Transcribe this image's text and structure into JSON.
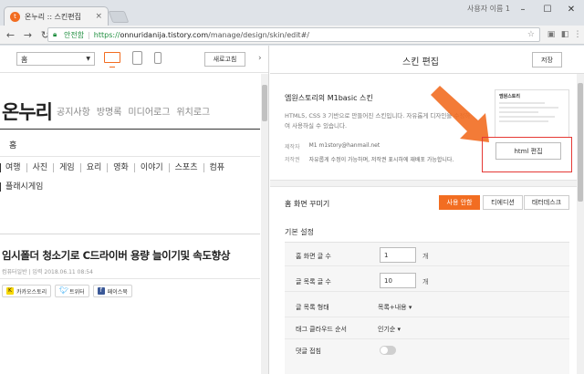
{
  "browser": {
    "tab_title": "온누리 :: 스킨편집",
    "tab_close": "×",
    "user_name": "사용자 이름 1",
    "win_min": "–",
    "win_max": "☐",
    "win_close": "✕",
    "back": "←",
    "forward": "→",
    "reload": "↻",
    "secure_label": "안전함",
    "url_scheme": "https://",
    "url_host": "onnuridanija.tistory.com",
    "url_path": "/manage/design/skin/edit#/",
    "star": "☆"
  },
  "preview": {
    "select_value": "홈",
    "refresh_label": "새로고침",
    "collapse": "›",
    "blog_title": "온누리",
    "nav": [
      "공지사항",
      "방명록",
      "미디어로그",
      "위치로그"
    ],
    "home_link": "홈",
    "categories": [
      "여행",
      "사진",
      "게임",
      "요리",
      "영화",
      "이야기",
      "스포츠",
      "컴퓨"
    ],
    "category_row2": "플래시게임",
    "post_title": "임시폴더 청소기로 C드라이버 용량 늘이기및 속도향상",
    "post_meta": "컴퓨터일반 | 입력 2018.06.11 08:54",
    "share": [
      "카카오스토리",
      "트위터",
      "페이스북"
    ]
  },
  "editor": {
    "title": "스킨 편집",
    "save_label": "저장",
    "skin_name": "엠원스토리의 M1basic 스킨",
    "skin_desc": "HTML5, CSS 3 기반으로 만들어진 스킨입니다. 자유롭게 디자인을 수정하여 사용하실 수 있습니다.",
    "author_label": "제작자",
    "author_value": "M1  m1story@hanmail.net",
    "copyright_label": "저작권",
    "copyright_value": "자유롭게 수정이 가능하며, 저작권 표시하에 재배포 가능합니다.",
    "thumb_title": "엠원스토리",
    "html_edit_label": "html 편집",
    "home_section_title": "홈 화면 꾸미기",
    "segments": [
      "사용 안함",
      "티에디션",
      "태터데스크"
    ],
    "basic_settings_title": "기본 설정",
    "settings": {
      "home_posts_label": "홈 화면 글 수",
      "home_posts_value": "1",
      "home_posts_unit": "개",
      "list_posts_label": "글 목록 글 수",
      "list_posts_value": "10",
      "list_posts_unit": "개",
      "list_type_label": "글 목록 형태",
      "list_type_value": "목록+내용 ▾",
      "tag_order_label": "태그 클라우드 순서",
      "tag_order_value": "인기순 ▾",
      "comment_fold_label": "댓글 접침"
    }
  },
  "colors": {
    "accent": "#f26d21",
    "highlight": "#e53935",
    "secure": "#1e8e3e"
  }
}
